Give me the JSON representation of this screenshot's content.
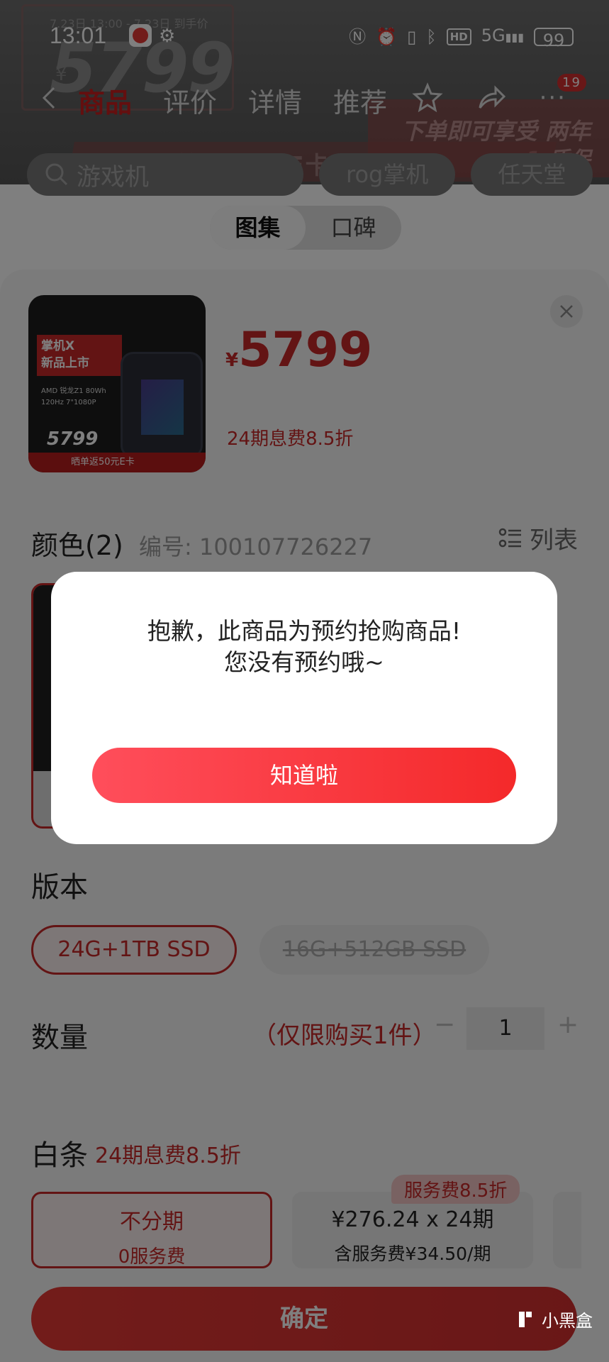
{
  "status_bar": {
    "time": "13:01",
    "battery": "99",
    "network": "5G",
    "hd": "HD"
  },
  "nav": {
    "tabs": [
      "商品",
      "评价",
      "详情",
      "推荐"
    ],
    "active_tab": "商品",
    "more_badge": "19"
  },
  "search": {
    "placeholder": "游戏机",
    "chips": [
      "rog掌机",
      "任天堂"
    ]
  },
  "background_banner": {
    "date_text": "7.23日 13:00 - 7.23日 到手价",
    "price": "5799",
    "yen": "¥",
    "slogan_line1": "下单即可享受 两年",
    "slogan_line2": "1 质保",
    "banner_text": "晒单返50元E卡"
  },
  "segment": {
    "items": [
      "图集",
      "口碑"
    ],
    "active": "图集"
  },
  "product": {
    "thumb": {
      "title_line1": "掌机X",
      "title_line2": "新品上市",
      "spec1": "AMD 锐龙Z1 80Wh",
      "spec2": "120Hz 7\"1080P",
      "price": "5799",
      "strip": "晒单返50元E卡"
    },
    "price_symbol": "¥",
    "price": "5799",
    "installment": "24期息费8.5折"
  },
  "color_section": {
    "title": "颜色(2)",
    "code": "编号: 100107726227",
    "list_toggle": "列表"
  },
  "version_section": {
    "title": "版本",
    "options": [
      "24G+1TB SSD",
      "16G+512GB SSD"
    ],
    "selected": "24G+1TB SSD"
  },
  "quantity_section": {
    "title": "数量",
    "limit": "（仅限购买1件）",
    "minus": "−",
    "value": "1",
    "plus": "+"
  },
  "baitiao_section": {
    "title": "白条",
    "subtitle": "24期息费8.5折",
    "plans": [
      {
        "main": "不分期",
        "sub": "0服务费"
      },
      {
        "main": "¥276.24 x 24期",
        "sub": "含服务费¥34.50/期",
        "tag": "服务费8.5折"
      }
    ]
  },
  "confirm_label": "确定",
  "watermark": "小黑盒",
  "dialog": {
    "line1": "抱歉，此商品为预约抢购商品!",
    "line2": "您没有预约哦~",
    "button": "知道啦"
  },
  "colors": {
    "accent": "#c62828",
    "dialog_button_start": "#ff4e5b",
    "dialog_button_end": "#f4292a"
  }
}
